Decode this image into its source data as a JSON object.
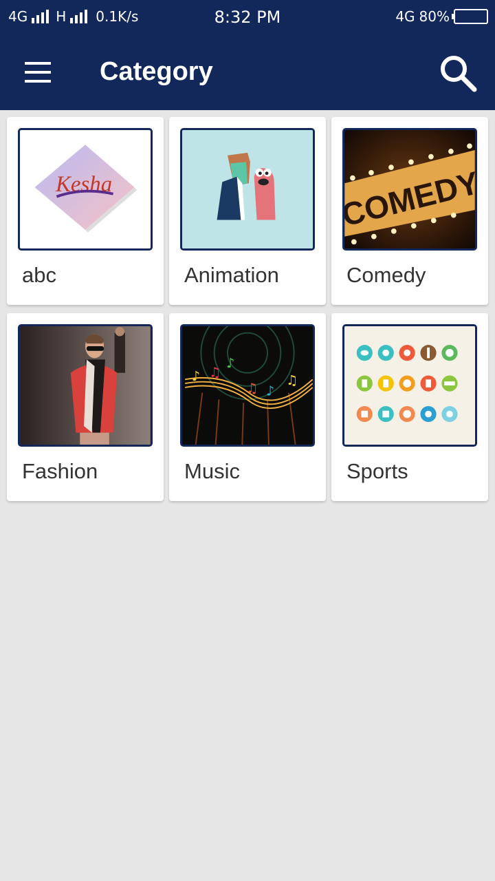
{
  "status_bar": {
    "network_1": "4G",
    "network_2": "H",
    "speed": "0.1K/s",
    "time": "8:32 PM",
    "network_3": "4G",
    "battery": "80%"
  },
  "app_bar": {
    "title": "Category",
    "menu_icon": "hamburger-menu-icon",
    "search_icon": "search-icon",
    "background_color": "#13285a"
  },
  "categories": [
    {
      "label": "abc",
      "thumbnail": "kesha-logo-image",
      "logo_text": "Kesha"
    },
    {
      "label": "Animation",
      "thumbnail": "animation-characters-image"
    },
    {
      "label": "Comedy",
      "thumbnail": "comedy-marquee-image",
      "sign_text": "COMEDY"
    },
    {
      "label": "Fashion",
      "thumbnail": "fashion-runway-image"
    },
    {
      "label": "Music",
      "thumbnail": "music-notes-image"
    },
    {
      "label": "Sports",
      "thumbnail": "sports-icons-image"
    }
  ]
}
